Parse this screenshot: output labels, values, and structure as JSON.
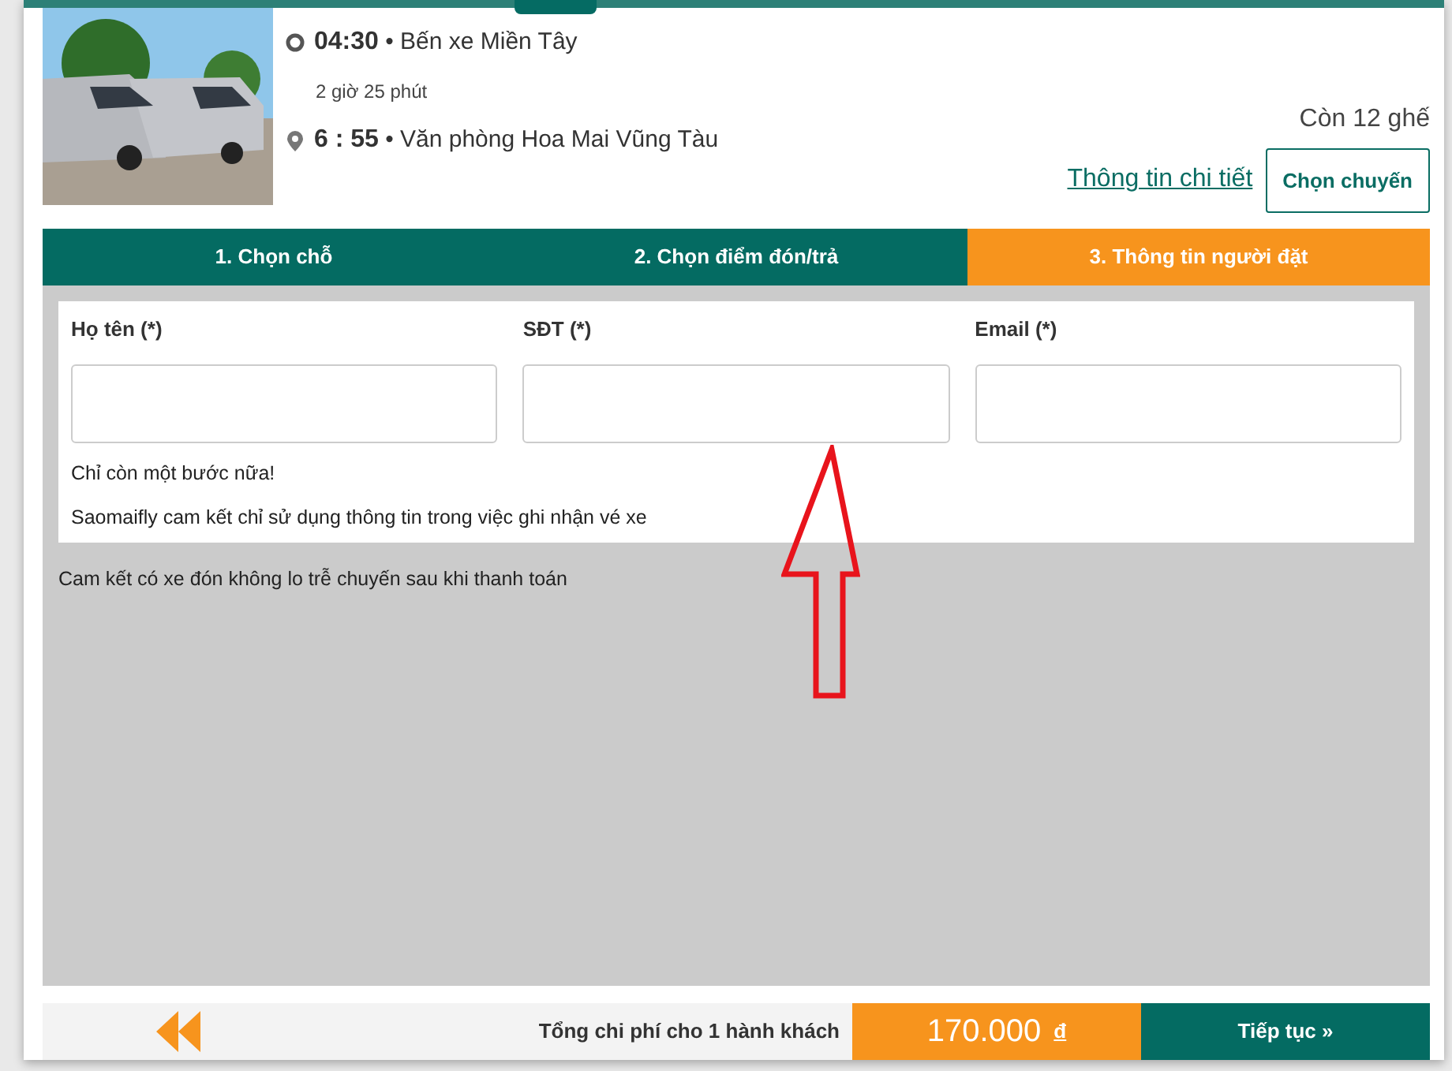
{
  "trip": {
    "depart_time": "04:30",
    "depart_place": "• Bến xe Miền Tây",
    "duration": "2 giờ 25 phút",
    "arrive_time": "6 : 55",
    "arrive_place": "• Văn phòng Hoa Mai Vũng Tàu",
    "seats_left": "Còn 12 ghế",
    "details_link": "Thông tin chi tiết",
    "choose_button": "Chọn chuyến"
  },
  "steps": [
    {
      "label": "1. Chọn chỗ",
      "selected": false
    },
    {
      "label": "2. Chọn điểm đón/trả",
      "selected": false
    },
    {
      "label": "3. Thông tin người đặt",
      "selected": true
    }
  ],
  "form": {
    "fields": [
      {
        "label": "Họ tên (*)"
      },
      {
        "label": "SĐT (*)"
      },
      {
        "label": "Email (*)"
      }
    ],
    "notes": [
      "Chỉ còn một bước nữa!",
      "Saomaifly cam kết chỉ sử dụng thông tin trong việc ghi nhận vé xe"
    ]
  },
  "promise": "Cam kết có xe đón không lo trễ chuyến sau khi thanh toán",
  "footer": {
    "total_label": "Tổng chi phí cho 1 hành khách",
    "price": "170.000",
    "currency": "đ",
    "next_button": "Tiếp tục »"
  }
}
